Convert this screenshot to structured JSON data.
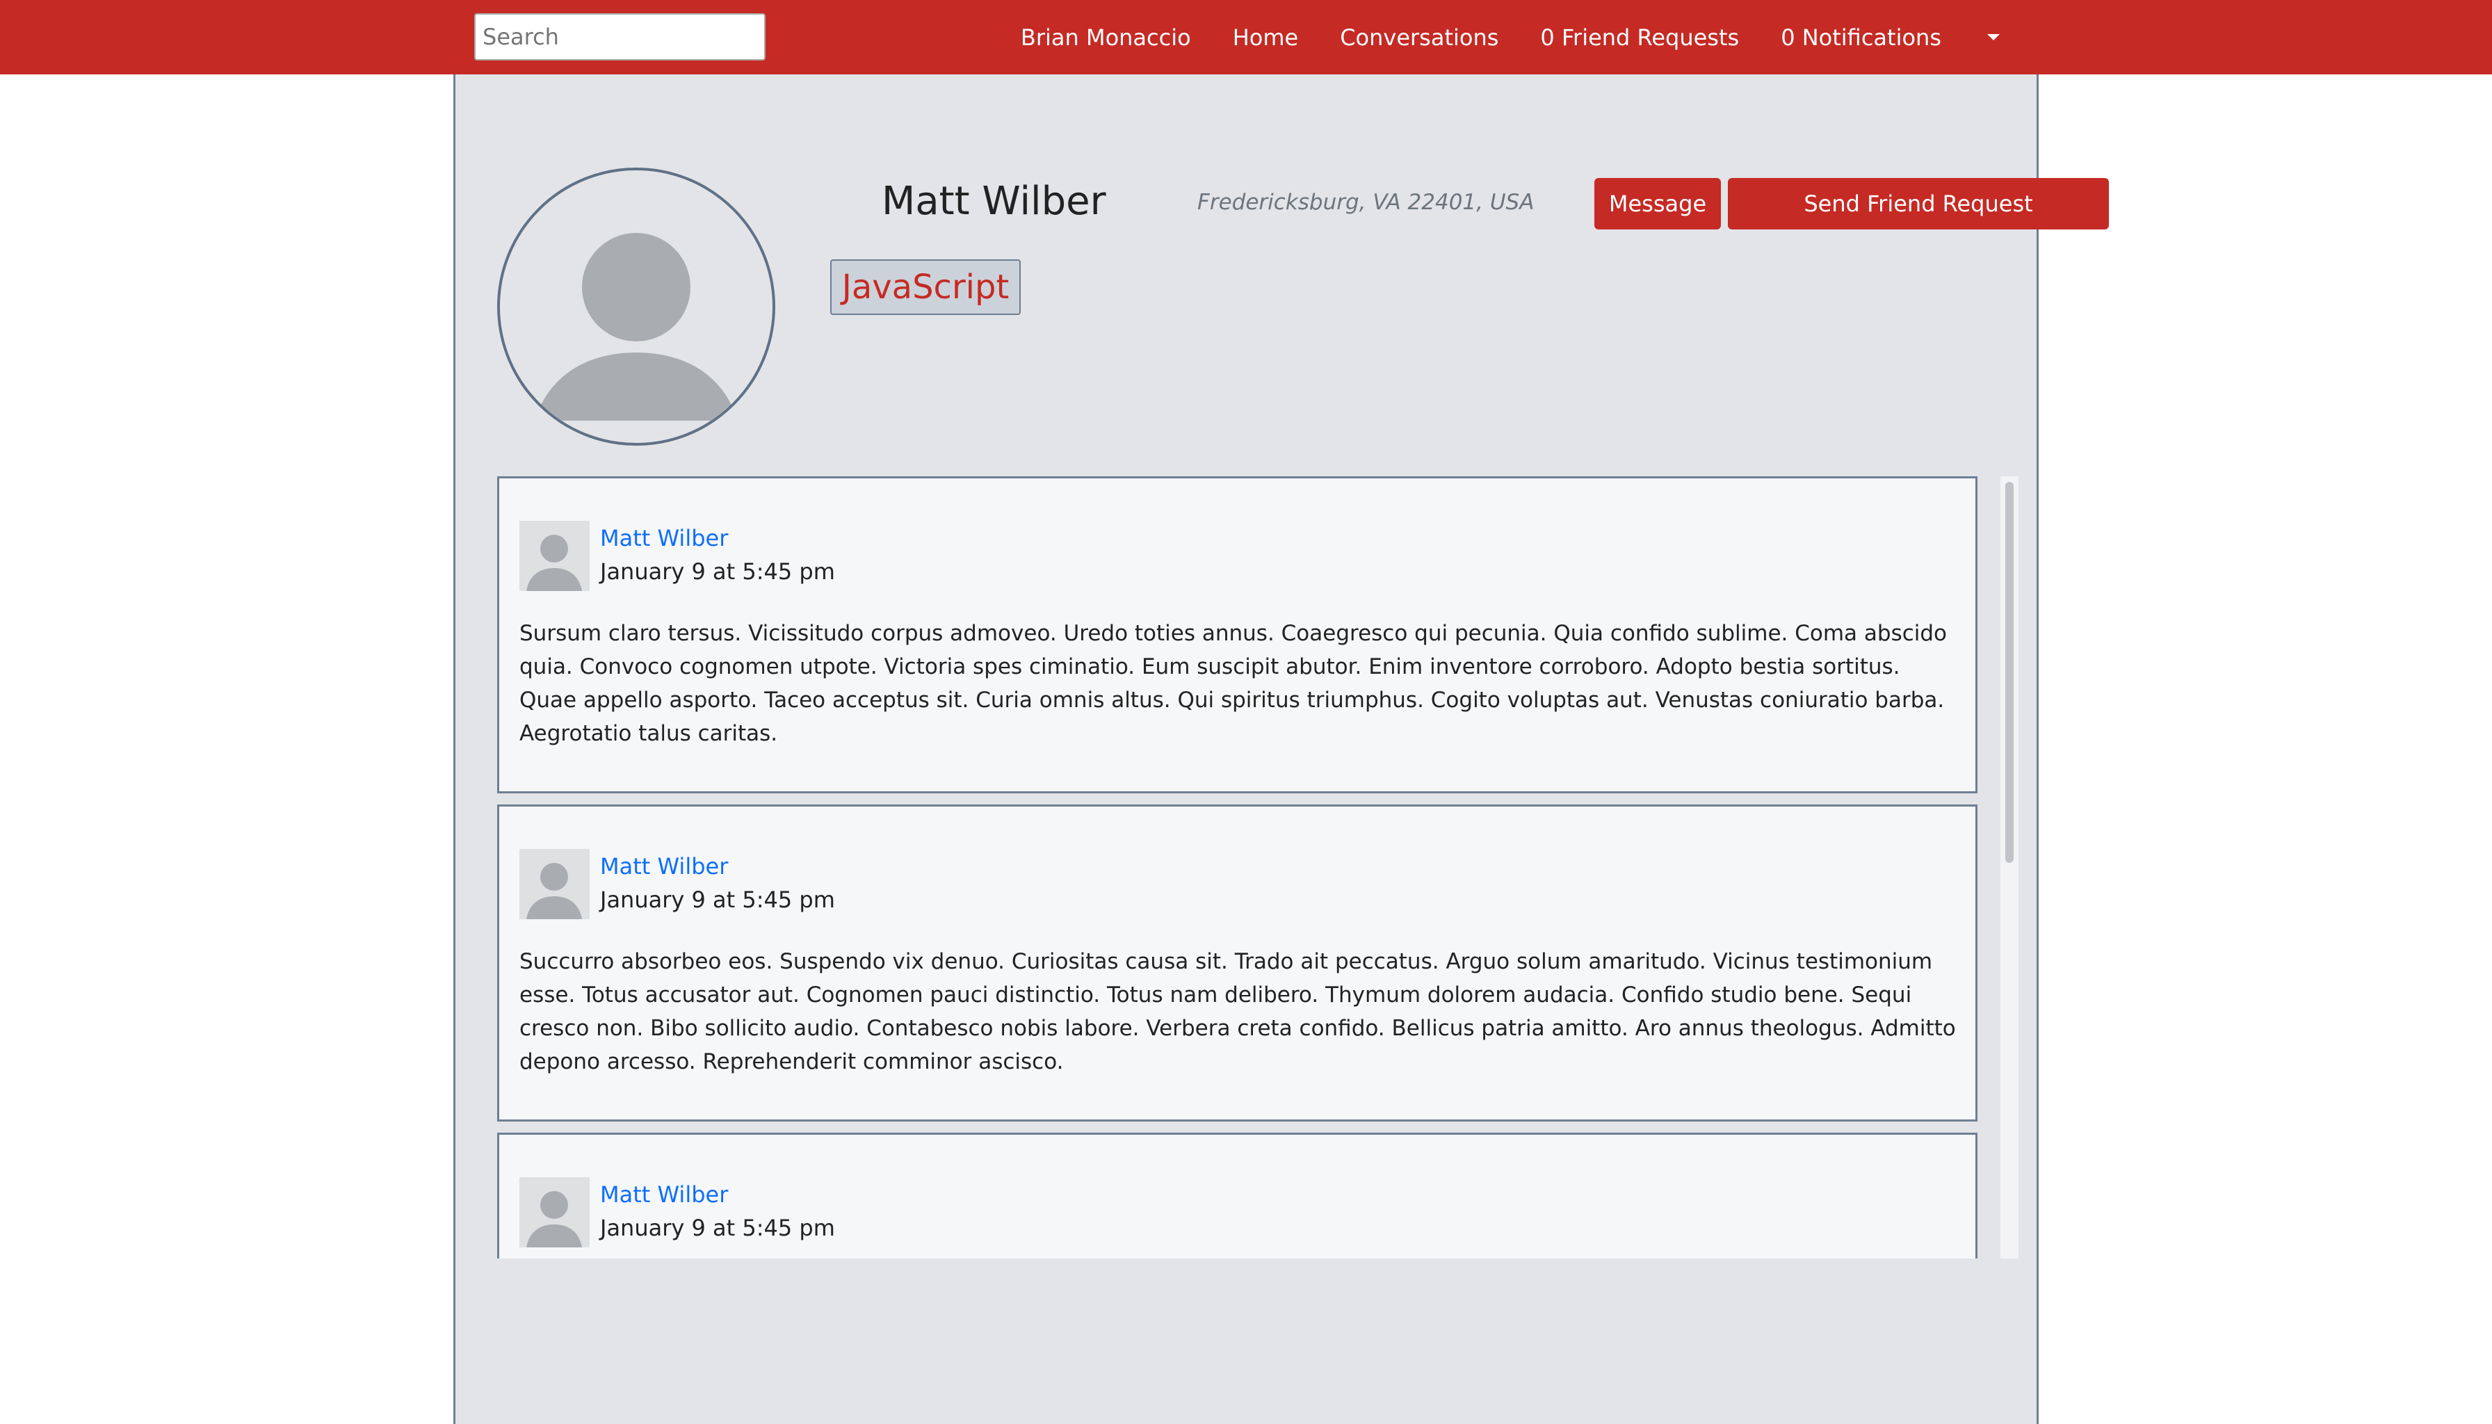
{
  "navbar": {
    "search_placeholder": "Search",
    "user_name": "Brian Monaccio",
    "home": "Home",
    "conversations": "Conversations",
    "friend_requests": "0 Friend Requests",
    "notifications": "0 Notifications",
    "color": "#c52a24"
  },
  "profile": {
    "name": "Matt Wilber",
    "location": "Fredericksburg, VA 22401, USA",
    "message_button": "Message",
    "friend_request_button": "Send Friend Request",
    "skills": [
      "JavaScript"
    ]
  },
  "posts": [
    {
      "author": "Matt Wilber",
      "date": "January 9 at 5:45 pm",
      "body": "Sursum claro tersus. Vicissitudo corpus admoveo. Uredo toties annus. Coaegresco qui pecunia. Quia confido sublime. Coma abscido quia. Convoco cognomen utpote. Victoria spes ciminatio. Eum suscipit abutor. Enim inventore corroboro. Adopto bestia sortitus. Quae appello asporto. Taceo acceptus sit. Curia omnis altus. Qui spiritus triumphus. Cogito voluptas aut. Venustas coniuratio barba. Aegrotatio talus caritas."
    },
    {
      "author": "Matt Wilber",
      "date": "January 9 at 5:45 pm",
      "body": "Succurro absorbeo eos. Suspendo vix denuo. Curiositas causa sit. Trado ait peccatus. Arguo solum amaritudo. Vicinus testimonium esse. Totus accusator aut. Cognomen pauci distinctio. Totus nam delibero. Thymum dolorem audacia. Confido studio bene. Sequi cresco non. Bibo sollicito audio. Contabesco nobis labore. Verbera creta confido. Bellicus patria amitto. Aro annus theologus. Admitto depono arcesso. Reprehenderit comminor ascisco."
    },
    {
      "author": "Matt Wilber",
      "date": "January 9 at 5:45 pm",
      "body": ""
    }
  ]
}
